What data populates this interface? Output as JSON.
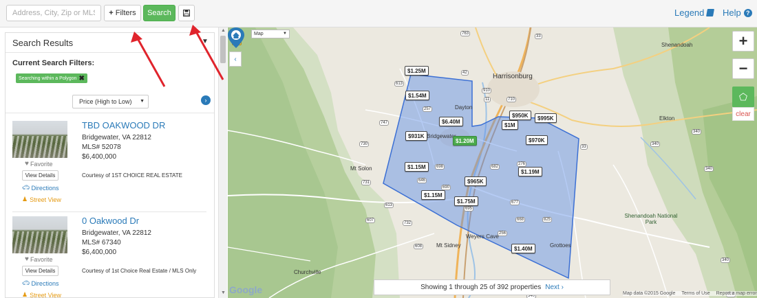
{
  "topbar": {
    "search_placeholder": "Address, City, Zip or MLS#",
    "filters_label": "Filters",
    "search_label": "Search",
    "legend_label": "Legend",
    "help_label": "Help"
  },
  "panel": {
    "title": "Search Results",
    "filters_heading": "Current Search Filters:",
    "filter_badge": "Searching within a Polygon",
    "sort_value": "Price (High to Low)"
  },
  "listings": [
    {
      "title": "TBD OAKWOOD DR",
      "address": "Bridgewater, VA 22812",
      "mls": "MLS# 52078",
      "price": "$6,400,000",
      "courtesy": "Courtesy of 1ST CHOICE REAL ESTATE",
      "favorite": "Favorite",
      "view_details": "View Details",
      "directions": "Directions",
      "street_view": "Street View"
    },
    {
      "title": "0 Oakwood Dr",
      "address": "Bridgewater, VA 22812",
      "mls": "MLS# 67340",
      "price": "$6,400,000",
      "courtesy": "Courtesy of 1st Choice Real Estate / MLS Only",
      "favorite": "Favorite",
      "view_details": "View Details",
      "directions": "Directions",
      "street_view": "Street View"
    }
  ],
  "map": {
    "type_select": "Map",
    "clear_label": "clear",
    "status_text": "Showing 1 through 25 of 392 properties",
    "next_label": "Next",
    "google_logo": "Google",
    "footer": [
      "Map data ©2015 Google",
      "Terms of Use",
      "Report a map error"
    ],
    "price_markers": [
      "$1.25M",
      "$1.54M",
      "$6.40M",
      "$931K",
      "$1.20M",
      "$1M",
      "$950K",
      "$995K",
      "$970K",
      "$1.15M",
      "$1.19M",
      "$965K",
      "$1.15M",
      "$1.75M",
      "$1.40M"
    ],
    "towns": [
      "Harrisonburg",
      "Dayton",
      "Bridgewater",
      "Mt Solon",
      "Weyers Cave",
      "Mt Sidney",
      "Grottoes",
      "Churchville",
      "Elkton",
      "Shenandoah",
      "Shenandoah National Park"
    ],
    "roads": [
      "763",
      "33",
      "613",
      "257",
      "42",
      "910",
      "710",
      "11",
      "730",
      "747",
      "698",
      "690",
      "682",
      "276",
      "646",
      "731",
      "613",
      "607",
      "732",
      "695",
      "256",
      "677",
      "668",
      "825",
      "340",
      "608",
      "33",
      "340",
      "340",
      "340",
      "340",
      "995"
    ]
  }
}
